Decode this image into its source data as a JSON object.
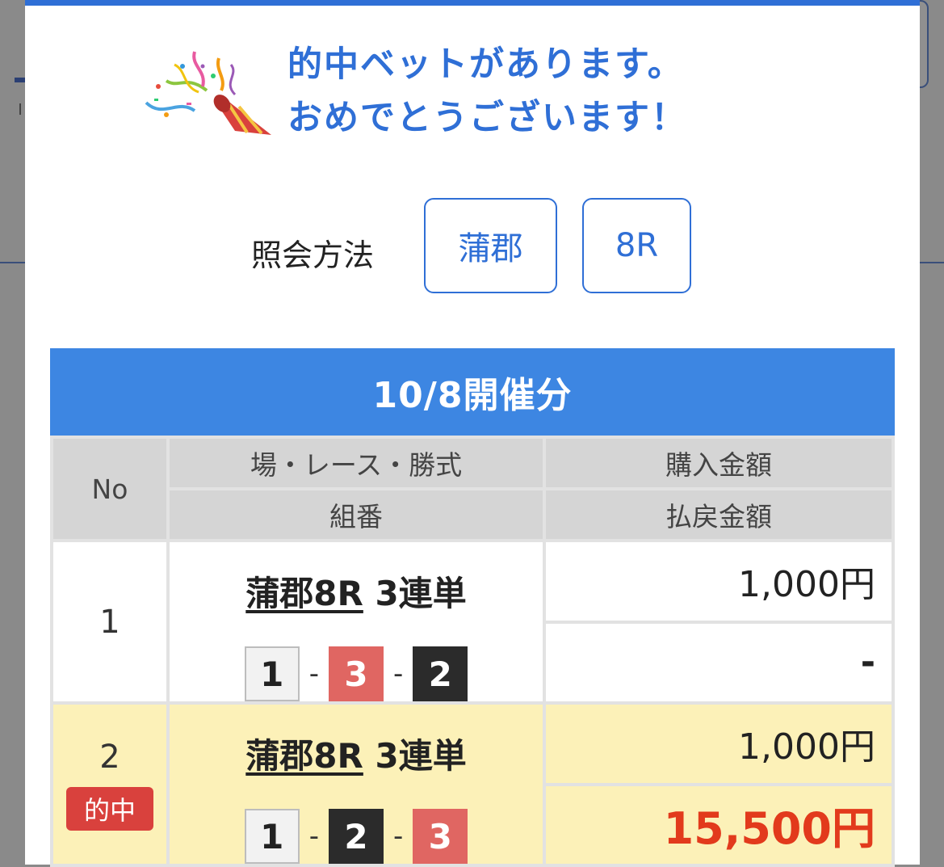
{
  "modal": {
    "headline_line1": "的中ベットがあります。",
    "headline_line2": "おめでとうございます！"
  },
  "method": {
    "label": "照会方法",
    "venue_button": "蒲郡",
    "race_button": "8R"
  },
  "date_header": "10/8開催分",
  "table": {
    "headers": {
      "no": "No",
      "race_type": "場・レース・勝式",
      "combination": "組番",
      "purchase": "購入金額",
      "payout": "払戻金額"
    },
    "rows": [
      {
        "no": "1",
        "race": "蒲郡8R",
        "bet_type": "3連単",
        "combo": [
          "1",
          "3",
          "2"
        ],
        "separator": "-",
        "purchase": "1,000円",
        "payout": "-",
        "hit": false
      },
      {
        "no": "2",
        "hit_label": "的中",
        "race": "蒲郡8R",
        "bet_type": "3連単",
        "combo": [
          "1",
          "2",
          "3"
        ],
        "separator": "-",
        "purchase": "1,000円",
        "payout": "15,500円",
        "hit": true
      }
    ]
  },
  "colors": {
    "accent": "#2f6fd6",
    "date_bar": "#3d86e2",
    "hit_row": "#fcf1b8",
    "hit_badge": "#d9413d",
    "payout_win": "#e23a1c"
  },
  "icons": {
    "banner": "party-popper-icon"
  }
}
